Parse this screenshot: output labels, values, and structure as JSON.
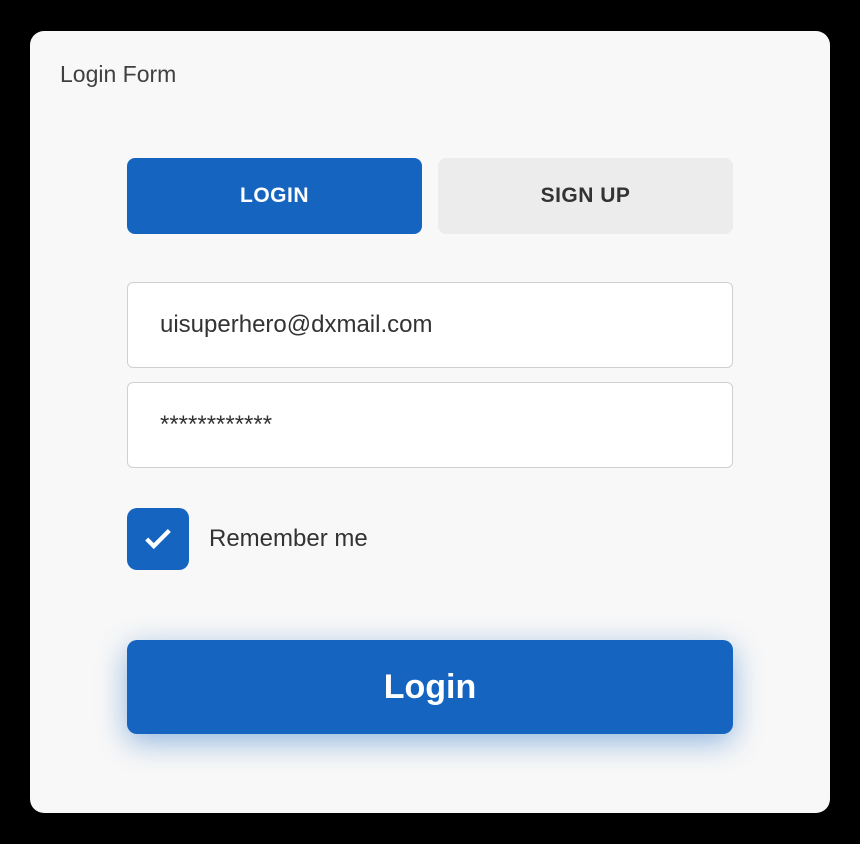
{
  "card": {
    "title": "Login Form"
  },
  "tabs": {
    "login": "LOGIN",
    "signup": "SIGN UP"
  },
  "fields": {
    "email_value": "uisuperhero@dxmail.com",
    "password_value": "************"
  },
  "remember": {
    "label": "Remember me",
    "checked": true
  },
  "actions": {
    "submit": "Login"
  },
  "colors": {
    "primary": "#1565c0",
    "card_bg": "#f8f8f8",
    "inactive_tab": "#ececec"
  }
}
